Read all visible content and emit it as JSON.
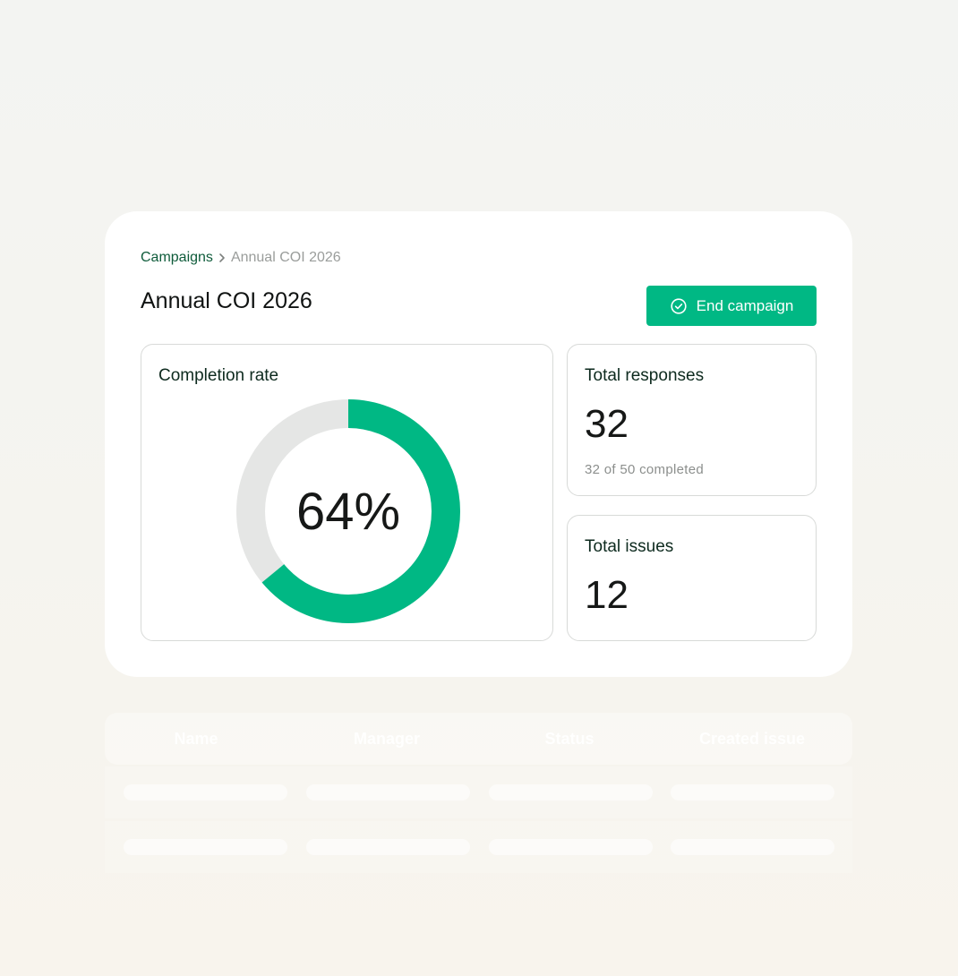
{
  "breadcrumb": {
    "parent": "Campaigns",
    "current": "Annual COI 2026",
    "separator_icon": "chevron-right-icon"
  },
  "header": {
    "title": "Annual COI 2026",
    "end_button_label": "End campaign",
    "end_button_icon": "check-circle-icon"
  },
  "completion": {
    "label": "Completion rate",
    "percent_label": "64%",
    "value": 64
  },
  "responses": {
    "label": "Total responses",
    "value": "32",
    "subtext": "32 of 50 completed"
  },
  "issues": {
    "label": "Total issues",
    "value": "12"
  },
  "table": {
    "columns": [
      "Name",
      "Manager",
      "Status",
      "Created issue"
    ]
  },
  "colors": {
    "accent": "#00b884",
    "track": "#e5e6e5",
    "breadcrumb_link": "#0e5b3a"
  }
}
